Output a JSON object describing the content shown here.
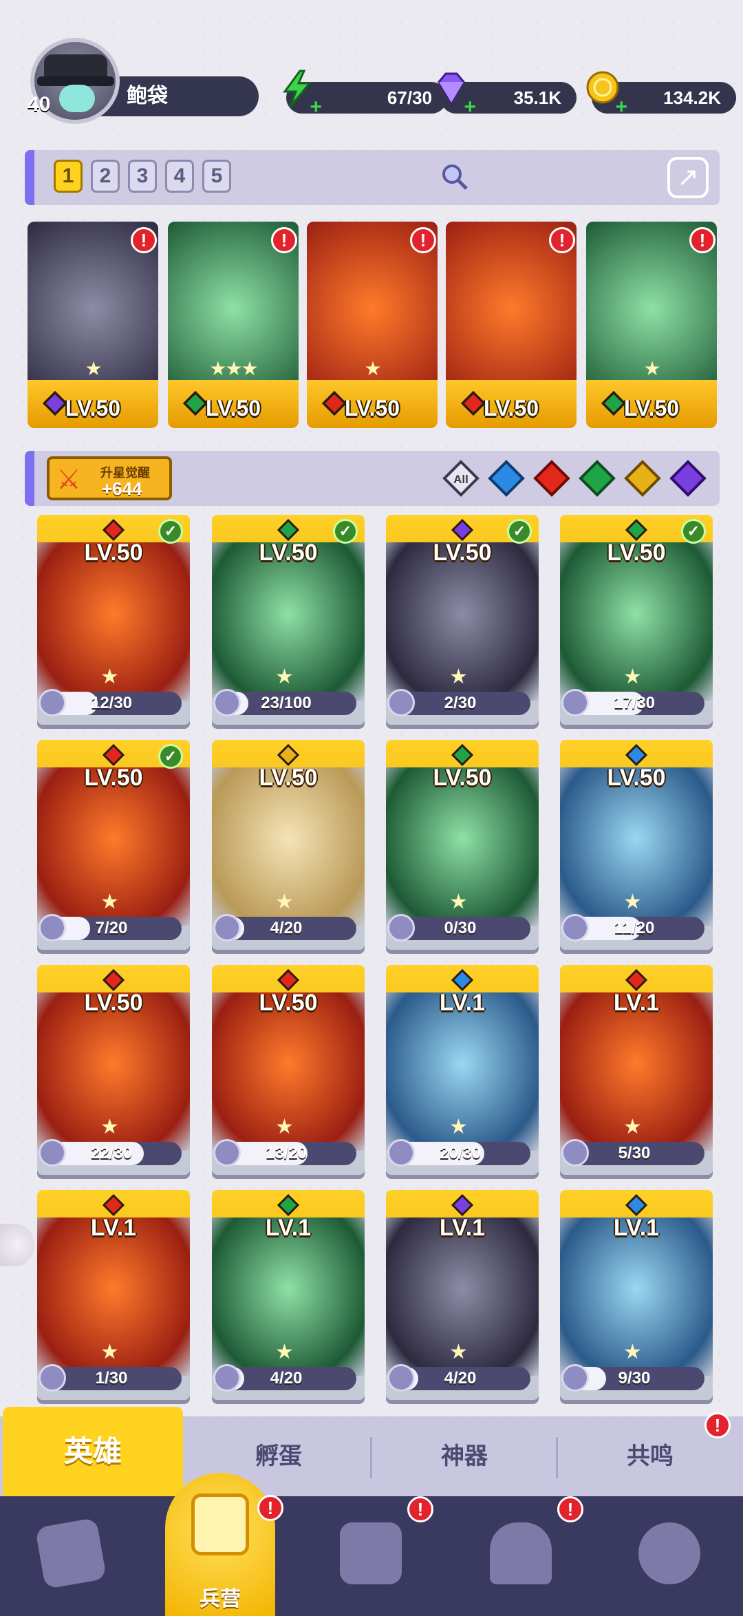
{
  "player": {
    "level": "40",
    "name": "鲍袋"
  },
  "resources": [
    {
      "name": "energy-icon",
      "value": "67/30",
      "color": "#3fd24a"
    },
    {
      "name": "gem-icon",
      "value": "35.1K",
      "color": "#7e4cf0"
    },
    {
      "name": "coin-icon",
      "value": "134.2K",
      "color": "#f4c21a"
    }
  ],
  "formation_tabs": [
    "1",
    "2",
    "3",
    "4",
    "5"
  ],
  "active_formation": "1",
  "team": [
    {
      "level": "LV.50",
      "element": "dark",
      "stars": "★",
      "alert": "!"
    },
    {
      "level": "LV.50",
      "element": "wind",
      "stars": "★★★",
      "alert": "!"
    },
    {
      "level": "LV.50",
      "element": "fire",
      "stars": "★",
      "alert": "!"
    },
    {
      "level": "LV.50",
      "element": "fire",
      "stars": "",
      "alert": "!"
    },
    {
      "level": "LV.50",
      "element": "wind",
      "stars": "★",
      "alert": "!"
    }
  ],
  "awaken": {
    "label": "升星觉醒",
    "count": "+644"
  },
  "filters": [
    "All",
    "water",
    "fire",
    "wind",
    "light",
    "dark"
  ],
  "heroes": [
    {
      "level": "LV.50",
      "element": "fire",
      "progress": "12/30",
      "ratio": 0.4,
      "checked": true
    },
    {
      "level": "LV.50",
      "element": "wind",
      "progress": "23/100",
      "ratio": 0.23,
      "checked": true
    },
    {
      "level": "LV.50",
      "element": "dark",
      "progress": "2/30",
      "ratio": 0.07,
      "checked": true
    },
    {
      "level": "LV.50",
      "element": "wind",
      "progress": "17/30",
      "ratio": 0.57,
      "checked": true
    },
    {
      "level": "LV.50",
      "element": "fire",
      "progress": "7/20",
      "ratio": 0.35,
      "checked": true
    },
    {
      "level": "LV.50",
      "element": "light",
      "progress": "4/20",
      "ratio": 0.2,
      "checked": false
    },
    {
      "level": "LV.50",
      "element": "wind",
      "progress": "0/30",
      "ratio": 0,
      "checked": false
    },
    {
      "level": "LV.50",
      "element": "water",
      "progress": "11/20",
      "ratio": 0.55,
      "checked": false
    },
    {
      "level": "LV.50",
      "element": "fire",
      "progress": "22/30",
      "ratio": 0.73,
      "checked": false
    },
    {
      "level": "LV.50",
      "element": "fire",
      "progress": "13/20",
      "ratio": 0.65,
      "checked": false
    },
    {
      "level": "LV.1",
      "element": "water",
      "progress": "20/30",
      "ratio": 0.67,
      "checked": false
    },
    {
      "level": "LV.1",
      "element": "fire",
      "progress": "5/30",
      "ratio": 0.17,
      "checked": false
    },
    {
      "level": "LV.1",
      "element": "fire",
      "progress": "1/30",
      "ratio": 0.03,
      "checked": false
    },
    {
      "level": "LV.1",
      "element": "wind",
      "progress": "4/20",
      "ratio": 0.2,
      "checked": false
    },
    {
      "level": "LV.1",
      "element": "dark",
      "progress": "4/20",
      "ratio": 0.2,
      "checked": false
    },
    {
      "level": "LV.1",
      "element": "water",
      "progress": "9/30",
      "ratio": 0.3,
      "checked": false
    }
  ],
  "subtabs": [
    {
      "label": "英雄",
      "active": true
    },
    {
      "label": "孵蛋",
      "active": false
    },
    {
      "label": "神器",
      "active": false
    },
    {
      "label": "共鸣",
      "active": false,
      "alert": "!"
    }
  ],
  "nav": {
    "barracks_label": "兵营",
    "alert": "!"
  },
  "element_colors": {
    "fire": "#e2281a",
    "water": "#2b8ae3",
    "wind": "#1fa546",
    "light": "#e8b11a",
    "dark": "#7b3ee0"
  }
}
